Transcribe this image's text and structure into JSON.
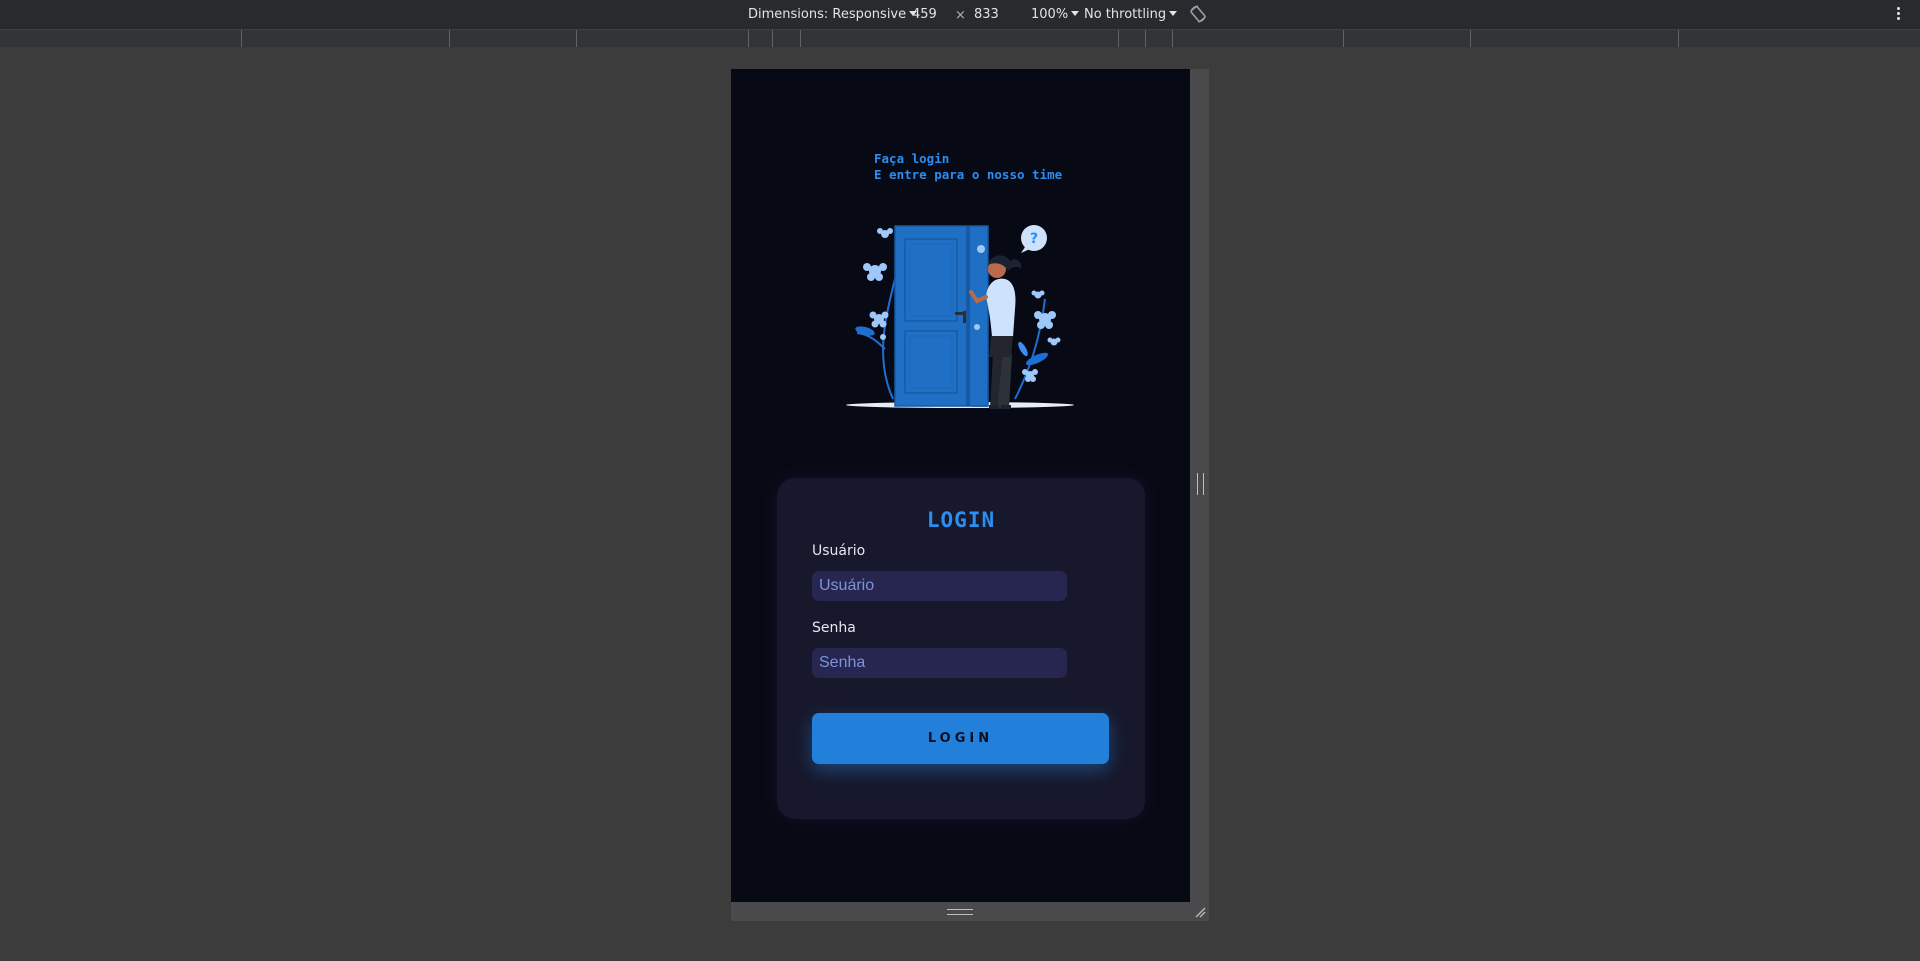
{
  "devtools": {
    "dimensions_label": "Dimensions: Responsive",
    "width_value": "459",
    "times_sign": "×",
    "height_value": "833",
    "zoom_label": "100%",
    "throttling_label": "No throttling"
  },
  "page": {
    "greeting_line1": "Faça login",
    "greeting_line2": "E entre para o nosso time",
    "login_title": "LOGIN",
    "username_label": "Usuário",
    "username_placeholder": "Usuário",
    "password_label": "Senha",
    "password_placeholder": "Senha",
    "login_button": "LOGIN"
  },
  "colors": {
    "accent": "#2b8ef0",
    "button": "#2380da",
    "background": "#070914",
    "card": "#17182b",
    "input": "#262650"
  },
  "icons": {
    "rotate": "rotate-icon",
    "more": "more-vertical-icon",
    "question": "question-bubble-icon"
  }
}
